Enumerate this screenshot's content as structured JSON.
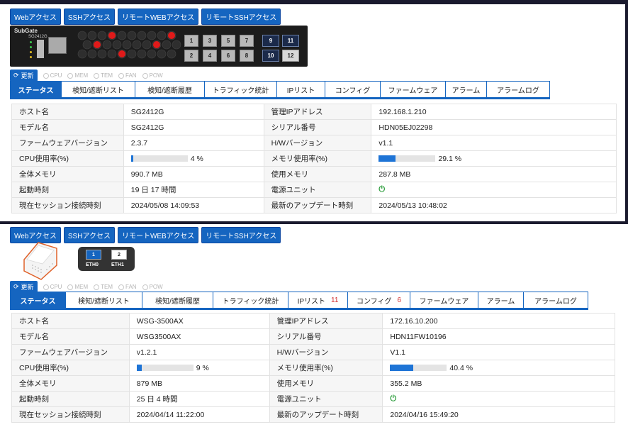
{
  "top": {
    "access_buttons": [
      "Webアクセス",
      "SSHアクセス",
      "リモートWEBアクセス",
      "リモートSSHアクセス"
    ],
    "device": {
      "logo": "SubGate",
      "model_label": "SG2412G",
      "ports": [
        "1",
        "2",
        "3",
        "4",
        "5",
        "6",
        "7",
        "8"
      ],
      "sfp_ports": [
        "9",
        "10",
        "11",
        "12"
      ]
    },
    "refresh": {
      "label": "更新",
      "indicators": [
        "CPU",
        "MEM",
        "TEM",
        "FAN",
        "POW"
      ]
    },
    "tabs": [
      {
        "label": "ステータス",
        "badge": ""
      },
      {
        "label": "検知/遮断リスト",
        "badge": ""
      },
      {
        "label": "検知/遮断履歴",
        "badge": ""
      },
      {
        "label": "トラフィック統計",
        "badge": ""
      },
      {
        "label": "IPリスト",
        "badge": ""
      },
      {
        "label": "コンフィグ",
        "badge": ""
      },
      {
        "label": "ファームウェア",
        "badge": ""
      },
      {
        "label": "アラーム",
        "badge": ""
      },
      {
        "label": "アラームログ",
        "badge": ""
      }
    ],
    "info": {
      "hostname_label": "ホスト名",
      "hostname": "SG2412G",
      "mgmt_ip_label": "管理IPアドレス",
      "mgmt_ip": "192.168.1.210",
      "model_label": "モデル名",
      "model": "SG2412G",
      "serial_label": "シリアル番号",
      "serial": "HDN05EJ02298",
      "fw_label": "ファームウェアバージョン",
      "fw": "2.3.7",
      "hw_label": "H/Wバージョン",
      "hw": "v1.1",
      "cpu_label": "CPU使用率(%)",
      "cpu_text": "4 %",
      "cpu_value": 4,
      "mem_label": "メモリ使用率(%)",
      "mem_text": "29.1 %",
      "mem_value": 29.1,
      "total_mem_label": "全体メモリ",
      "total_mem": "990.7 MB",
      "used_mem_label": "使用メモリ",
      "used_mem": "287.8 MB",
      "uptime_label": "起動時刻",
      "uptime": "19 日 17 時間",
      "psu_label": "電源ユニット",
      "session_label": "現在セッション接続時刻",
      "session": "2024/05/08 14:09:53",
      "update_label": "最新のアップデート時刻",
      "update": "2024/05/13 10:48:02"
    }
  },
  "bottom": {
    "access_buttons": [
      "Webアクセス",
      "SSHアクセス",
      "リモートWEBアクセス",
      "リモートSSHアクセス"
    ],
    "device": {
      "eth_ports": [
        {
          "num": "1",
          "label": "ETH0"
        },
        {
          "num": "2",
          "label": "ETH1"
        }
      ]
    },
    "refresh": {
      "label": "更新",
      "indicators": [
        "CPU",
        "MEM",
        "TEM",
        "FAN",
        "POW"
      ]
    },
    "tabs": [
      {
        "label": "ステータス",
        "badge": ""
      },
      {
        "label": "検知/遮断リスト",
        "badge": ""
      },
      {
        "label": "検知/遮断履歴",
        "badge": ""
      },
      {
        "label": "トラフィック統計",
        "badge": ""
      },
      {
        "label": "IPリスト",
        "badge": "11"
      },
      {
        "label": "コンフィグ",
        "badge": "6"
      },
      {
        "label": "ファームウェア",
        "badge": ""
      },
      {
        "label": "アラーム",
        "badge": ""
      },
      {
        "label": "アラームログ",
        "badge": ""
      }
    ],
    "info": {
      "hostname_label": "ホスト名",
      "hostname": "WSG-3500AX",
      "mgmt_ip_label": "管理IPアドレス",
      "mgmt_ip": "172.16.10.200",
      "model_label": "モデル名",
      "model": "WSG3500AX",
      "serial_label": "シリアル番号",
      "serial": "HDN11FW10196",
      "fw_label": "ファームウェアバージョン",
      "fw": "v1.2.1",
      "hw_label": "H/Wバージョン",
      "hw": "V1.1",
      "cpu_label": "CPU使用率(%)",
      "cpu_text": "9 %",
      "cpu_value": 9,
      "mem_label": "メモリ使用率(%)",
      "mem_text": "40.4 %",
      "mem_value": 40.4,
      "total_mem_label": "全体メモリ",
      "total_mem": "879 MB",
      "used_mem_label": "使用メモリ",
      "used_mem": "355.2 MB",
      "uptime_label": "起動時刻",
      "uptime": "25 日 4 時間",
      "psu_label": "電源ユニット",
      "session_label": "現在セッション接続時刻",
      "session": "2024/04/14 11:22:00",
      "update_label": "最新のアップデート時刻",
      "update": "2024/04/16 15:49:20"
    }
  },
  "colors": {
    "accent": "#1565c0",
    "bar_fill": "#1e74d6",
    "power_on": "#2e9e3e",
    "badge": "#d32f2f",
    "frame": "#1a1a2e"
  }
}
